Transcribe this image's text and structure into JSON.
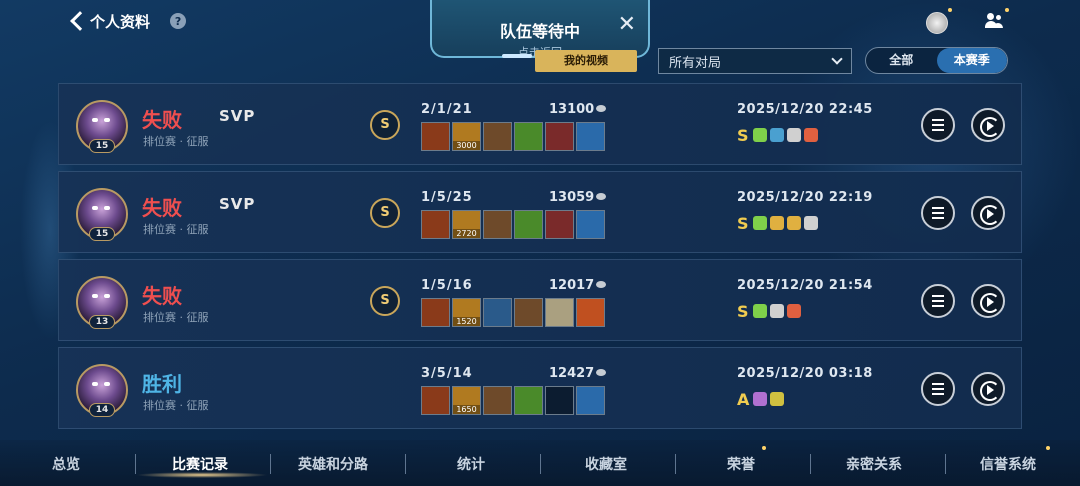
{
  "header": {
    "title": "个人资料",
    "help": "?"
  },
  "team_panel": {
    "title": "队伍等待中",
    "subtitle": "点击返回",
    "close": "✕"
  },
  "toolbar": {
    "my_video_label": "我的视频",
    "filter_value": "所有对局",
    "toggle": [
      "全部",
      "本赛季"
    ],
    "toggle_active": "本赛季"
  },
  "matches": [
    {
      "result": "失败",
      "result_type": "lose",
      "svp": "SVP",
      "mode": "排位赛 · 征服",
      "level": "15",
      "rank_badge": "S",
      "kda": "2/1/21",
      "gold": "13100",
      "items": [
        {
          "color": "#8a3a1a"
        },
        {
          "color": "#b07a20",
          "n": "3000"
        },
        {
          "color": "#6e4a2a"
        },
        {
          "color": "#4a8a2a"
        },
        {
          "color": "#7a2a2a"
        },
        {
          "color": "#2a6aaa"
        }
      ],
      "time": "2025/12/20 22:45",
      "grade": "S",
      "tags": [
        "#7fd04a",
        "#4aa0d0",
        "#d0d0d0",
        "#e06040"
      ]
    },
    {
      "result": "失败",
      "result_type": "lose",
      "svp": "SVP",
      "mode": "排位赛 · 征服",
      "level": "15",
      "rank_badge": "S",
      "kda": "1/5/25",
      "gold": "13059",
      "items": [
        {
          "color": "#8a3a1a"
        },
        {
          "color": "#b07a20",
          "n": "2720"
        },
        {
          "color": "#6e4a2a"
        },
        {
          "color": "#4a8a2a"
        },
        {
          "color": "#7a2a2a"
        },
        {
          "color": "#2a6aaa"
        }
      ],
      "time": "2025/12/20 22:19",
      "grade": "S",
      "tags": [
        "#7fd04a",
        "#e0b040",
        "#e0b040",
        "#d0d0d0"
      ]
    },
    {
      "result": "失败",
      "result_type": "lose",
      "svp": "",
      "mode": "排位赛 · 征服",
      "level": "13",
      "rank_badge": "S",
      "kda": "1/5/16",
      "gold": "12017",
      "items": [
        {
          "color": "#8a3a1a"
        },
        {
          "color": "#b07a20",
          "n": "1520"
        },
        {
          "color": "#2a5a8a"
        },
        {
          "color": "#6e4a2a"
        },
        {
          "color": "#aaa080"
        },
        {
          "color": "#c05020"
        }
      ],
      "time": "2025/12/20 21:54",
      "grade": "S",
      "tags": [
        "#7fd04a",
        "#d0d0d0",
        "#e06040"
      ]
    },
    {
      "result": "胜利",
      "result_type": "win",
      "svp": "",
      "mode": "排位赛 · 征服",
      "level": "14",
      "rank_badge": "",
      "kda": "3/5/14",
      "gold": "12427",
      "items": [
        {
          "color": "#8a3a1a"
        },
        {
          "color": "#b07a20",
          "n": "1650"
        },
        {
          "color": "#6e4a2a"
        },
        {
          "color": "#4a8a2a"
        },
        {
          "color": "#0c1c30",
          "empty": true
        },
        {
          "color": "#2a6aaa"
        }
      ],
      "time": "2025/12/20 03:18",
      "grade": "A",
      "tags": [
        "#b070d0",
        "#d0c040"
      ]
    }
  ],
  "bottom_nav": [
    "总览",
    "比赛记录",
    "英雄和分路",
    "统计",
    "收藏室",
    "荣誉",
    "亲密关系",
    "信誉系统"
  ],
  "bottom_nav_active": "比赛记录"
}
